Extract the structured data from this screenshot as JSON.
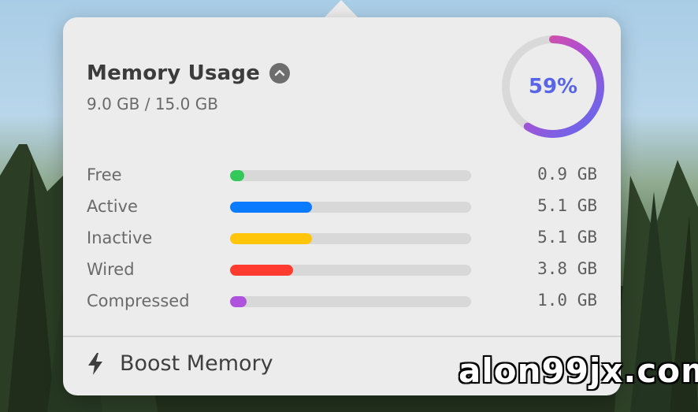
{
  "panel": {
    "title": "Memory Usage",
    "subtitle": "9.0 GB / 15.0 GB",
    "usage_percent": 59,
    "usage_label": "59%"
  },
  "rows": [
    {
      "label": "Free",
      "value": "0.9 GB",
      "fraction": 0.06,
      "color": "#34c759"
    },
    {
      "label": "Active",
      "value": "5.1 GB",
      "fraction": 0.34,
      "color": "#0a7aff"
    },
    {
      "label": "Inactive",
      "value": "5.1 GB",
      "fraction": 0.34,
      "color": "#ffc50a"
    },
    {
      "label": "Wired",
      "value": "3.8 GB",
      "fraction": 0.26,
      "color": "#ff3b30"
    },
    {
      "label": "Compressed",
      "value": "1.0 GB",
      "fraction": 0.07,
      "color": "#af52de"
    }
  ],
  "footer": {
    "boost_label": "Boost Memory",
    "boost_icon": "bolt-icon"
  },
  "collapse_icon": "chevron-up-icon",
  "ring_colors": {
    "start": "#5b6bf0",
    "mid": "#b04fd0",
    "end": "#ec4f8a",
    "track": "#d9d9d9"
  },
  "watermark": "alon99jx.com"
}
